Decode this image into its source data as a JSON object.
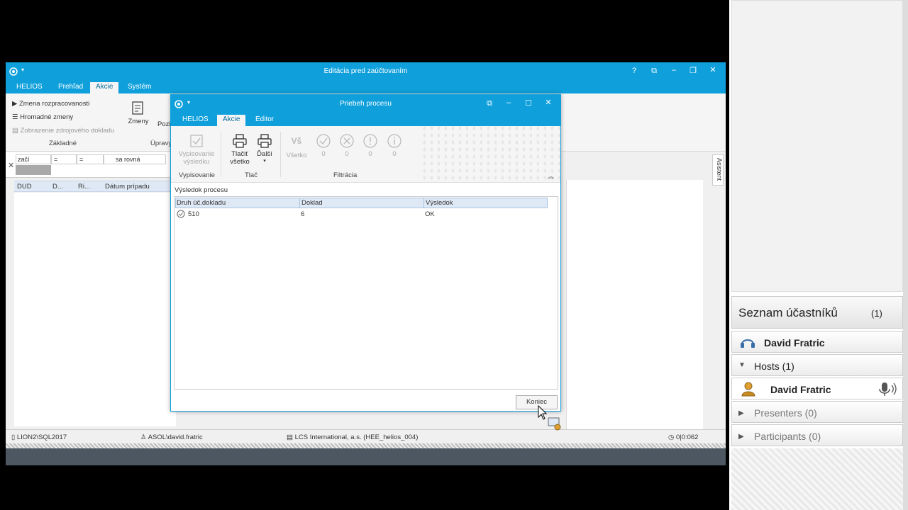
{
  "app": {
    "title": "Editácia pred zaúčtovaním",
    "tabs": [
      "HELIOS",
      "Prehľad",
      "Akcie",
      "Systém"
    ],
    "ribbon_items": {
      "zmena": "Zmena rozpracovanosti",
      "hromadne": "Hromadné zmeny",
      "zobrazenie": "Zobrazenie zdrojového dokladu",
      "zmeny": "Zmeny",
      "poz": "Pozi"
    },
    "groups": {
      "zakladne": "Základné",
      "upravy": "Úpravy"
    },
    "filter": {
      "c1": "začí",
      "c2": "=",
      "c3": "=",
      "c4": "sa rovná"
    },
    "grid_headers": [
      "DUD",
      "D...",
      "Ri...",
      "Dátum prípadu"
    ],
    "asistent": "Asistent"
  },
  "status": {
    "server": "LION2\\SQL2017",
    "user": "ASOL\\david.fratric",
    "company": "LCS International, a.s. (HEE_helios_004)",
    "time": "0|0:062"
  },
  "dialog": {
    "title": "Priebeh procesu",
    "tabs": [
      "HELIOS",
      "Akcie",
      "Editor"
    ],
    "buttons": {
      "vypisovanie": "Vypisovanie výsledku",
      "tlacit": "Tlačiť všetko",
      "dalsi": "Ďalší",
      "vsetko": "Všetko",
      "vsetko_icon": "Vš"
    },
    "counts": [
      "0",
      "0",
      "0",
      "0"
    ],
    "groups": {
      "vypisovanie": "Vypisovanie",
      "tlac": "Tlač",
      "filtracia": "Filtrácia"
    },
    "result_title": "Výsledok procesu",
    "columns": [
      "Druh úč.dokladu",
      "Doklad",
      "Výsledok"
    ],
    "rows": [
      {
        "druh": "510",
        "doklad": "6",
        "vysledok": "OK"
      }
    ],
    "koniec": "Koniec"
  },
  "panel": {
    "title": "Seznam účastníků",
    "count": "(1)",
    "me": "David Fratric",
    "hosts": "Hosts (1)",
    "host_name": "David Fratric",
    "presenters": "Presenters (0)",
    "participants": "Participants (0)"
  }
}
